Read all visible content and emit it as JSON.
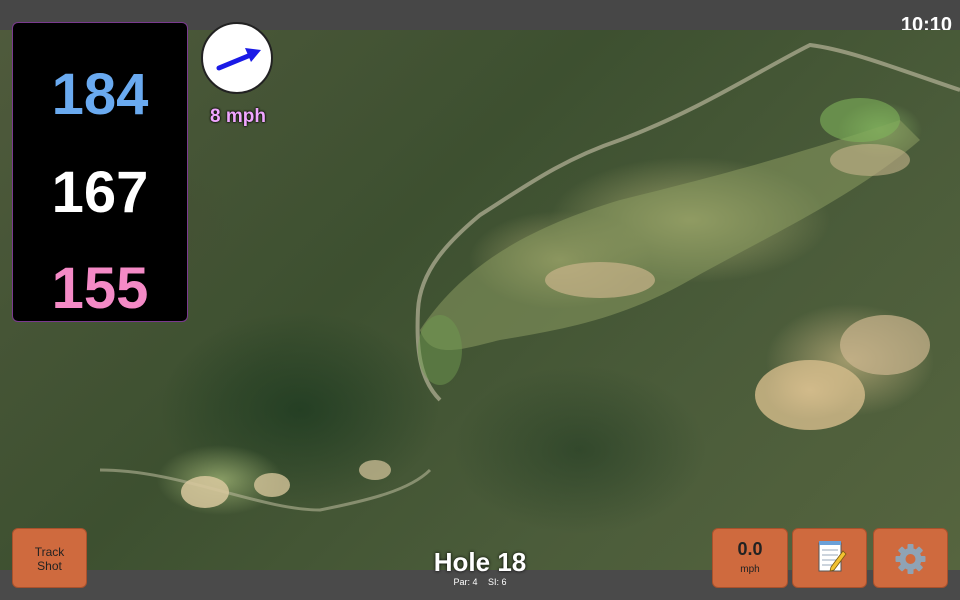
{
  "status_bar": {
    "time": "10:10"
  },
  "distances": {
    "back": "184",
    "middle": "167",
    "front": "155"
  },
  "wind": {
    "speed_label": "8 mph",
    "direction_icon": "wind-arrow-icon",
    "arrow_color": "#1a1ae6"
  },
  "track_shot_button": {
    "label_line1": "Track",
    "label_line2": "Shot"
  },
  "speed_button": {
    "value": "0.0",
    "unit": "mph"
  },
  "notes_button": {
    "icon": "notepad-icon"
  },
  "settings_button": {
    "icon": "gear-icon"
  },
  "hole": {
    "title": "Hole 18",
    "par": "Par: 4",
    "si": "SI: 6"
  },
  "colors": {
    "button_orange": "#cf6a3e",
    "back_blue": "#6aaaf0",
    "front_pink": "#f48ac6",
    "wind_text": "#f0a6ff"
  }
}
